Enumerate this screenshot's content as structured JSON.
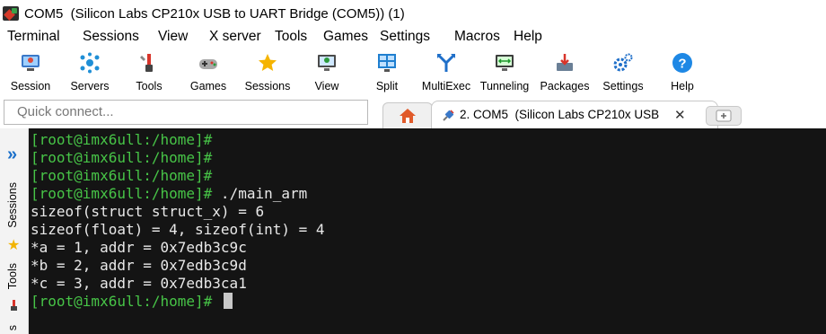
{
  "window": {
    "title": "COM5  (Silicon Labs CP210x USB to UART Bridge (COM5)) (1)"
  },
  "menu": [
    "Terminal",
    "Sessions",
    "View",
    "X server",
    "Tools",
    "Games",
    "Settings",
    "Macros",
    "Help"
  ],
  "toolbar": [
    {
      "label": "Session",
      "icon": "session-icon"
    },
    {
      "label": "Servers",
      "icon": "servers-icon"
    },
    {
      "label": "Tools",
      "icon": "tools-icon"
    },
    {
      "label": "Games",
      "icon": "games-icon"
    },
    {
      "label": "Sessions",
      "icon": "star-icon"
    },
    {
      "label": "View",
      "icon": "view-icon"
    },
    {
      "label": "Split",
      "icon": "split-icon"
    },
    {
      "label": "MultiExec",
      "icon": "multiexec-icon"
    },
    {
      "label": "Tunneling",
      "icon": "tunneling-icon"
    },
    {
      "label": "Packages",
      "icon": "packages-icon"
    },
    {
      "label": "Settings",
      "icon": "gear-icon"
    },
    {
      "label": "Help",
      "icon": "help-icon"
    }
  ],
  "quick_connect": {
    "placeholder": "Quick connect..."
  },
  "tabs": {
    "active_label": "2. COM5  (Silicon Labs CP210x USB",
    "close": "✕"
  },
  "sidebar": {
    "expand": "»",
    "sessions": "Sessions",
    "tools": "Tools",
    "partial": "s"
  },
  "terminal": {
    "lines": [
      {
        "prompt": "[root@imx6ull:/home]#",
        "text": ""
      },
      {
        "prompt": "[root@imx6ull:/home]#",
        "text": ""
      },
      {
        "prompt": "[root@imx6ull:/home]#",
        "text": ""
      },
      {
        "prompt": "[root@imx6ull:/home]#",
        "text": " ./main_arm"
      },
      {
        "prompt": "",
        "text": "sizeof(struct struct_x) = 6"
      },
      {
        "prompt": "",
        "text": "sizeof(float) = 4, sizeof(int) = 4"
      },
      {
        "prompt": "",
        "text": "*a = 1, addr = 0x7edb3c9c"
      },
      {
        "prompt": "",
        "text": "*b = 2, addr = 0x7edb3c9d"
      },
      {
        "prompt": "",
        "text": "*c = 3, addr = 0x7edb3ca1"
      },
      {
        "prompt": "[root@imx6ull:/home]#",
        "text": " "
      }
    ]
  },
  "colors": {
    "prompt": "#47c447",
    "terminal_bg": "#141414",
    "terminal_fg": "#e9e9e9",
    "accent": "#1a6fc9"
  }
}
